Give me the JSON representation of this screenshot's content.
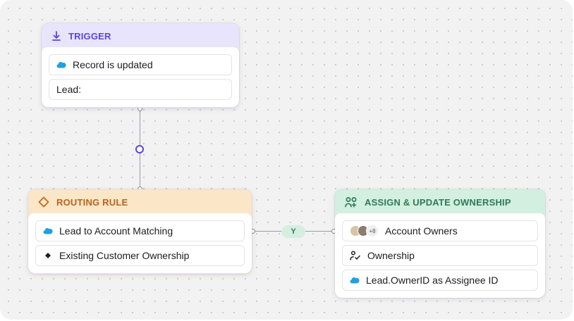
{
  "colors": {
    "trigger_header_bg": "#e7e4fb",
    "trigger_accent": "#5b46d8",
    "routing_header_bg": "#fbe6c8",
    "routing_accent": "#b8641c",
    "assign_header_bg": "#d3efdf",
    "assign_accent": "#2f7a56",
    "salesforce_blue": "#1fa0e0",
    "yes_badge_bg": "#d4efe0"
  },
  "trigger": {
    "title": "TRIGGER",
    "icon": "arrow-down-to-line-icon",
    "rows": [
      {
        "icon": "salesforce-cloud-icon",
        "label": "Record is updated"
      },
      {
        "label": "Lead:"
      }
    ]
  },
  "routing": {
    "title": "ROUTING RULE",
    "icon": "diamond-icon",
    "rows": [
      {
        "icon": "salesforce-cloud-icon",
        "label": "Lead to Account Matching"
      },
      {
        "icon": "diamond-filled-icon",
        "label": "Existing Customer Ownership"
      }
    ]
  },
  "connector": {
    "yes_label": "Y"
  },
  "assign": {
    "title": "ASSIGN & UPDATE OWNERSHIP",
    "icon": "users-group-icon",
    "rows": [
      {
        "icon": "avatar-stack",
        "extra_count": "+8",
        "label": "Account Owners"
      },
      {
        "icon": "user-check-icon",
        "label": "Ownership"
      },
      {
        "icon": "salesforce-cloud-icon",
        "label": "Lead.OwnerID as Assignee ID"
      }
    ]
  }
}
